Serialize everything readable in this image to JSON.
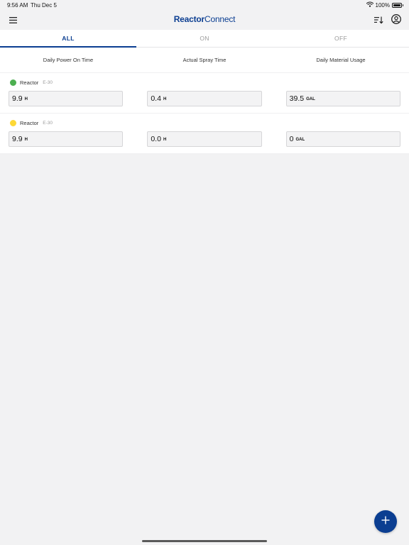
{
  "status_bar": {
    "time": "9:56 AM",
    "date": "Thu Dec 5",
    "battery": "100%",
    "battery_level": 1.0,
    "wifi_icon": "wifi-icon"
  },
  "header": {
    "logo_part1": "Reactor",
    "logo_part2": "Connect",
    "menu_icon": "hamburger-menu-icon",
    "sort_icon": "sort-icon",
    "account_icon": "account-icon"
  },
  "tabs": [
    {
      "label": "ALL",
      "active": true
    },
    {
      "label": "ON",
      "active": false
    },
    {
      "label": "OFF",
      "active": false
    }
  ],
  "columns": [
    "Daily Power On Time",
    "Actual Spray Time",
    "Daily Material Usage"
  ],
  "reactors": [
    {
      "name": "Reactor",
      "model": "E-30",
      "status_color": "#4caf50",
      "values": [
        {
          "value": "9.9",
          "unit": "H"
        },
        {
          "value": "0.4",
          "unit": "H"
        },
        {
          "value": "39.5",
          "unit": "GAL"
        }
      ]
    },
    {
      "name": "Reactor",
      "model": "E-30",
      "status_color": "#fdd835",
      "values": [
        {
          "value": "9.9",
          "unit": "H"
        },
        {
          "value": "0.0",
          "unit": "H"
        },
        {
          "value": "0",
          "unit": "GAL"
        }
      ]
    }
  ],
  "fab": {
    "icon": "plus-icon"
  },
  "colors": {
    "accent": "#0b3e91",
    "background": "#f2f2f3"
  }
}
